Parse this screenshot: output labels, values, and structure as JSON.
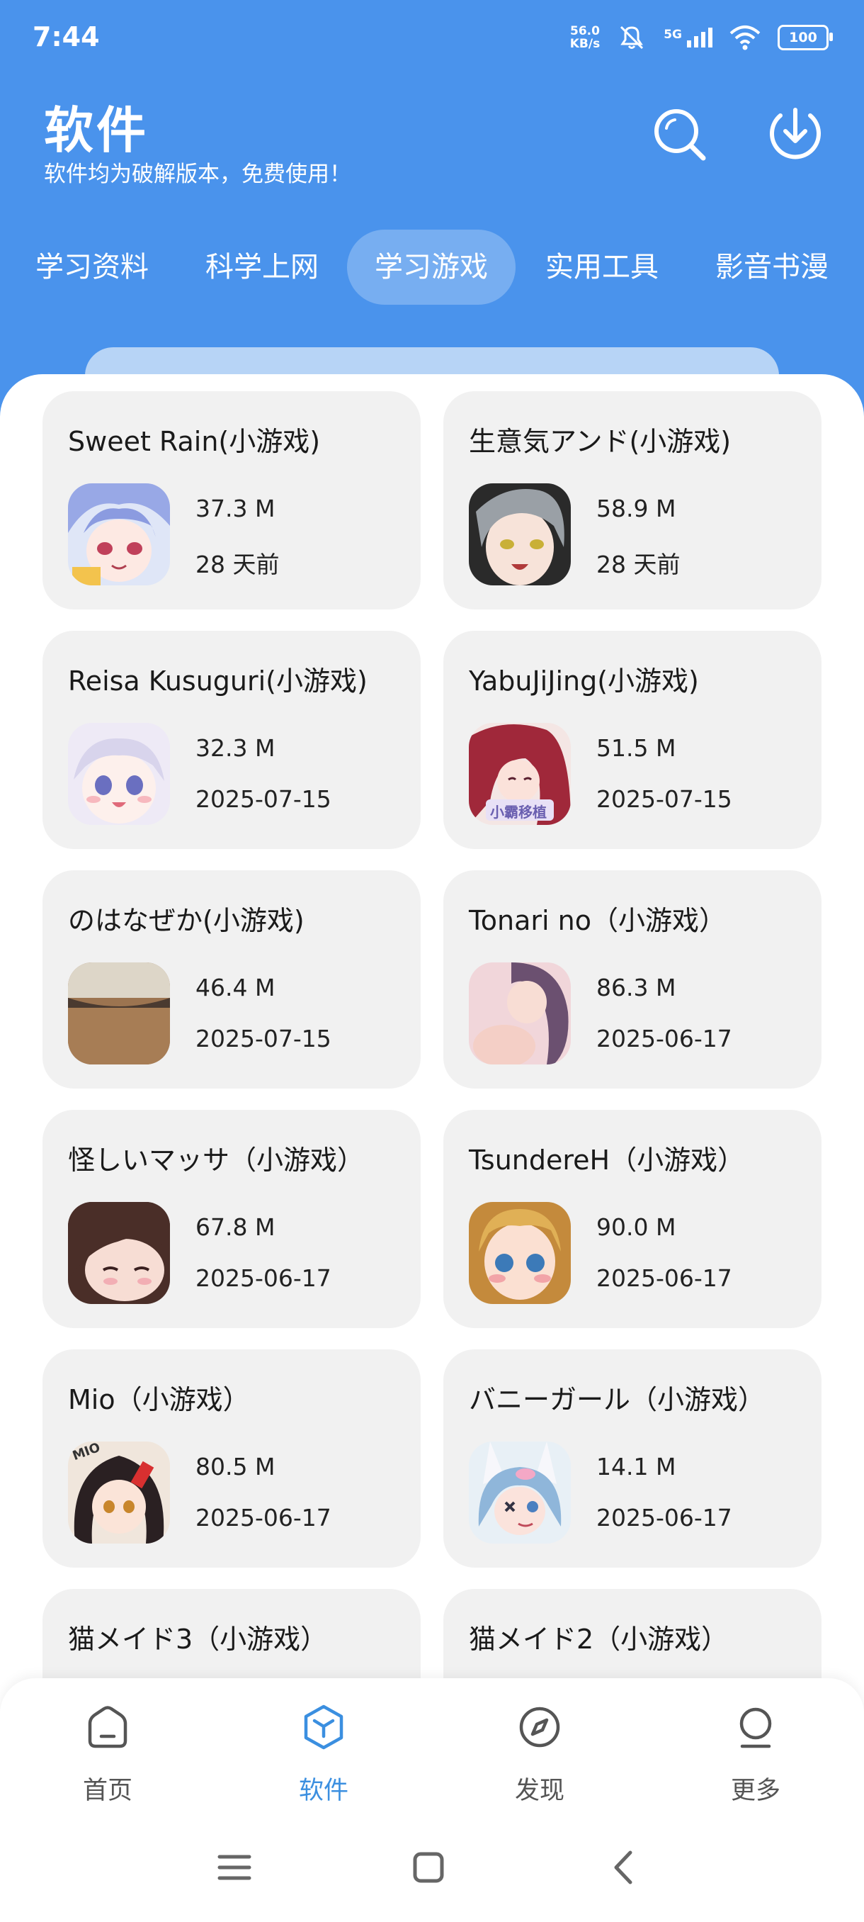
{
  "status_bar": {
    "time": "7:44",
    "net_speed_value": "56.0",
    "net_speed_unit": "KB/s",
    "network": "5G",
    "battery": "100"
  },
  "header": {
    "title": "软件",
    "subtitle": "软件均为破解版本，免费使用！",
    "search_icon": "search-icon",
    "download_icon": "download-icon"
  },
  "tabs": [
    {
      "label": "学习资料",
      "active": false
    },
    {
      "label": "科学上网",
      "active": false
    },
    {
      "label": "学习游戏",
      "active": true
    },
    {
      "label": "实用工具",
      "active": false
    },
    {
      "label": "影音书漫",
      "active": false
    }
  ],
  "apps": [
    {
      "title": "Sweet Rain(小游戏)",
      "size": "37.3 M",
      "date": "28 天前"
    },
    {
      "title": "生意気アンド(小游戏)",
      "size": "58.9 M",
      "date": "28 天前"
    },
    {
      "title": "Reisa Kusuguri(小游戏)",
      "size": "32.3 M",
      "date": "2025-07-15"
    },
    {
      "title": "YabuJiJing(小游戏)",
      "size": "51.5 M",
      "date": "2025-07-15"
    },
    {
      "title": "のはなぜか(小游戏)",
      "size": "46.4 M",
      "date": "2025-07-15"
    },
    {
      "title": "Tonari no（小游戏）",
      "size": "86.3 M",
      "date": "2025-06-17"
    },
    {
      "title": "怪しいマッサ（小游戏）",
      "size": "67.8 M",
      "date": "2025-06-17"
    },
    {
      "title": "TsundereH（小游戏）",
      "size": "90.0 M",
      "date": "2025-06-17"
    },
    {
      "title": "Mio（小游戏）",
      "size": "80.5 M",
      "date": "2025-06-17"
    },
    {
      "title": "バニーガール（小游戏）",
      "size": "14.1 M",
      "date": "2025-06-17"
    },
    {
      "title": "猫メイド3（小游戏）",
      "size": "",
      "date": ""
    },
    {
      "title": "猫メイド2（小游戏）",
      "size": "",
      "date": ""
    }
  ],
  "icon_watermark": "小霸移植",
  "icon_badge": "MIO",
  "bottom_nav": [
    {
      "label": "首页",
      "icon": "home-icon",
      "active": false
    },
    {
      "label": "软件",
      "icon": "cube-icon",
      "active": true
    },
    {
      "label": "发现",
      "icon": "compass-icon",
      "active": false
    },
    {
      "label": "更多",
      "icon": "person-icon",
      "active": false
    }
  ],
  "colors": {
    "header_blue": "#4a93ec",
    "card_bg": "#f1f1f1",
    "active_nav": "#3b8fe0"
  }
}
